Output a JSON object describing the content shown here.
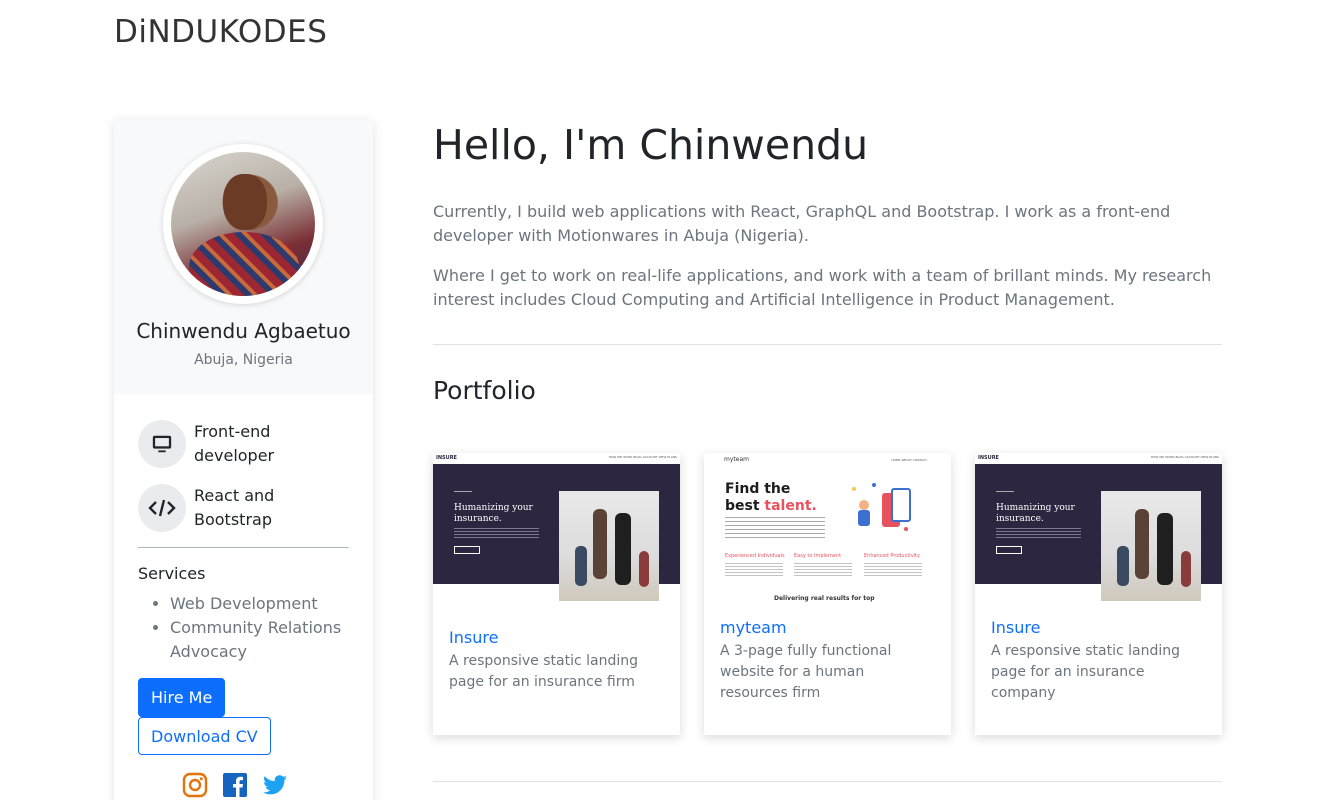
{
  "brand": "DiNDUKODES",
  "profile": {
    "name": "Chinwendu Agbaetuo",
    "location": "Abuja, Nigeria"
  },
  "skills": [
    {
      "label": "Front-end developer",
      "icon": "monitor-icon"
    },
    {
      "label": "React and Bootstrap",
      "icon": "code-icon"
    }
  ],
  "services": {
    "title": "Services",
    "items": [
      "Web Development",
      "Community Relations Advocacy"
    ]
  },
  "buttons": {
    "hire": "Hire Me",
    "cv": "Download CV"
  },
  "socials": [
    "instagram-icon",
    "facebook-icon",
    "twitter-icon"
  ],
  "hero": {
    "title": "Hello, I'm Chinwendu",
    "paragraphs": [
      "Currently, I build web applications with React, GraphQL and Bootstrap. I work as a front-end developer with Motionwares in Abuja (Nigeria).",
      "Where I get to work on real-life applications, and work with a team of brillant minds. My research interest includes Cloud Computing and Artificial Intelligence in Product Management."
    ]
  },
  "portfolio": {
    "title": "Portfolio",
    "cards": [
      {
        "title": "Insure",
        "description": "A responsive static landing page for an insurance firm"
      },
      {
        "title": "myteam",
        "description": "A 3-page fully functional website for a human resources firm"
      },
      {
        "title": "Insure",
        "description": "A responsive static landing page for an insurance company"
      }
    ]
  },
  "thumbs": {
    "insure": {
      "logo": "INSURE",
      "nav": "HOW WE WORK   BLOG   ACCOUNT   VIEW PLANS",
      "headline": "Humanizing your insurance."
    },
    "myteam": {
      "logo": "myteam",
      "nav": "HOME   ABOUT   CONTACT",
      "headline_a": "Find the",
      "headline_b": "best ",
      "headline_accent": "talent.",
      "features": [
        "Experienced Individuals",
        "Easy to Implement",
        "Enhanced Productivity"
      ],
      "bottom": "Delivering real results for top"
    }
  },
  "colors": {
    "primary": "#0d6efd",
    "muted": "#6c757d",
    "insure_dark": "#2c2640",
    "myteam_accent": "#e8525e"
  }
}
